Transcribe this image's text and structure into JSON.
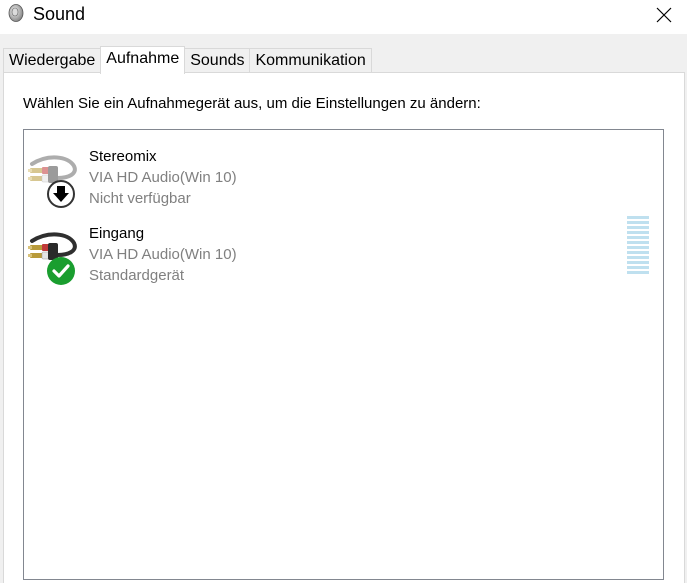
{
  "window": {
    "title": "Sound",
    "icon": "speaker-icon",
    "close_icon": "close-icon"
  },
  "tabs": [
    {
      "label": "Wiedergabe",
      "active": false
    },
    {
      "label": "Aufnahme",
      "active": true
    },
    {
      "label": "Sounds",
      "active": false
    },
    {
      "label": "Kommunikation",
      "active": false
    }
  ],
  "panel": {
    "instruction": "Wählen Sie ein Aufnahmegerät aus, um die Einstellungen zu ändern:"
  },
  "devices": [
    {
      "name": "Stereomix",
      "driver": "VIA HD Audio(Win 10)",
      "status": "Nicht verfügbar",
      "badge_icon": "down-arrow-badge-icon",
      "disabled": true
    },
    {
      "name": "Eingang",
      "driver": "VIA HD Audio(Win 10)",
      "status": "Standardgerät",
      "badge_icon": "check-badge-icon",
      "disabled": false,
      "level": 0
    }
  ],
  "colors": {
    "default_badge": "#1a9e2f",
    "level_meter": "#bfe0ef",
    "list_border": "#828790"
  }
}
